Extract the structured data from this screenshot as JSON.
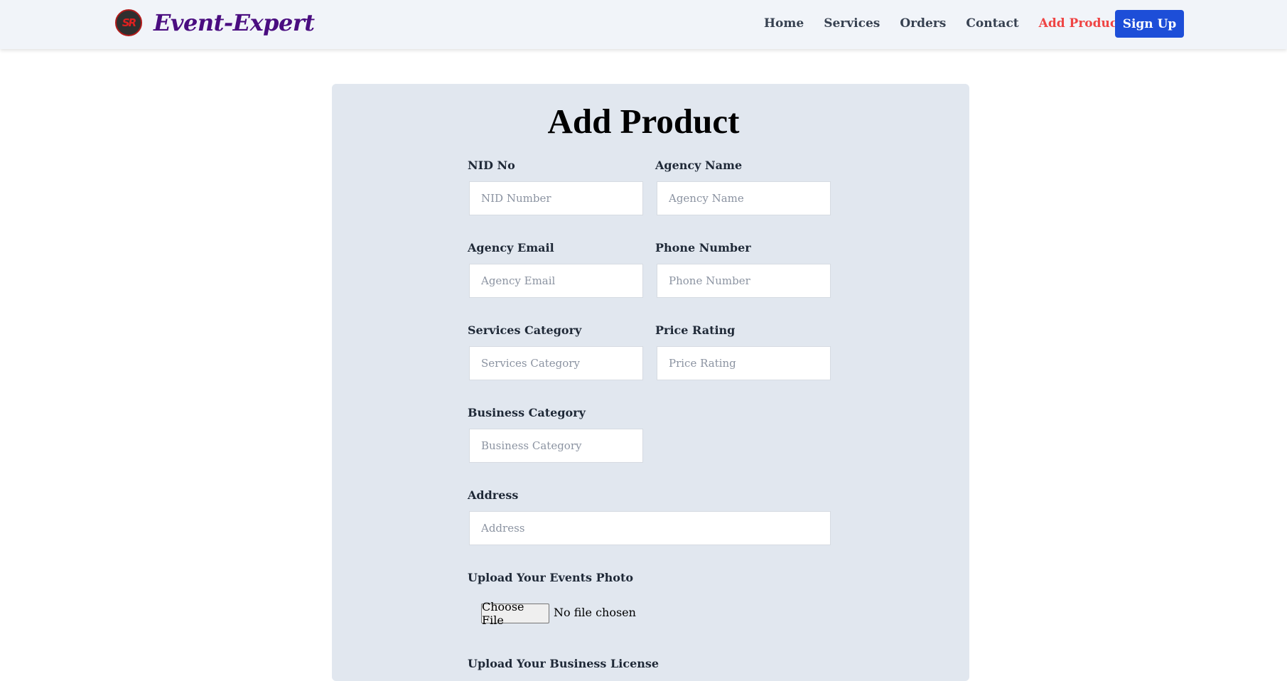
{
  "brand": {
    "logo_text": "SR",
    "name": "Event-Expert"
  },
  "nav": {
    "links": [
      {
        "label": "Home"
      },
      {
        "label": "Services"
      },
      {
        "label": "Orders"
      },
      {
        "label": "Contact"
      },
      {
        "label": "Add Product",
        "active": true
      }
    ],
    "signup_label": "Sign Up"
  },
  "form": {
    "title": "Add Product",
    "nid": {
      "label": "NID No",
      "placeholder": "NID Number"
    },
    "agency_name": {
      "label": "Agency Name",
      "placeholder": "Agency Name"
    },
    "agency_email": {
      "label": "Agency Email",
      "placeholder": "Agency Email"
    },
    "phone": {
      "label": "Phone Number",
      "placeholder": "Phone Number"
    },
    "services_category": {
      "label": "Services Category",
      "placeholder": "Services Category"
    },
    "price_rating": {
      "label": "Price Rating",
      "placeholder": "Price Rating"
    },
    "business_category": {
      "label": "Business Category",
      "placeholder": "Business Category"
    },
    "address": {
      "label": "Address",
      "placeholder": "Address"
    },
    "events_photo": {
      "label": "Upload Your Events Photo",
      "button": "Choose File",
      "status": "No file chosen"
    },
    "business_license": {
      "label": "Upload Your Business License"
    }
  },
  "colors": {
    "nav_bg": "#f1f4f9",
    "brand": "#4a0d80",
    "active_link": "#ef4444",
    "signup_bg": "#1d4ed8",
    "card_bg": "#e1e7ef"
  }
}
